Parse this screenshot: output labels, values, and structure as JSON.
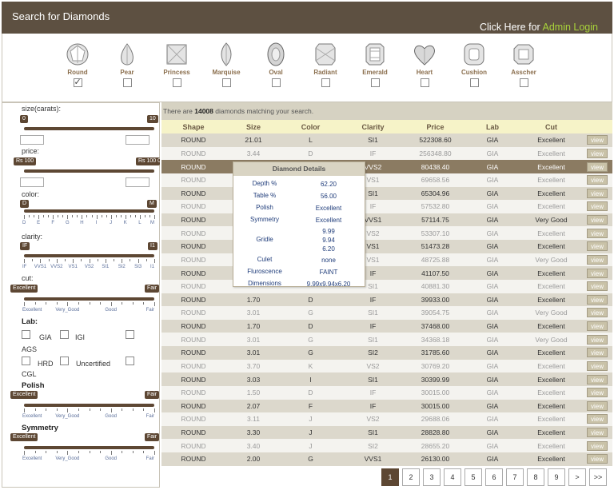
{
  "header": {
    "title": "Search for Diamonds",
    "admin_prefix": "Click Here for",
    "admin_link": "Admin Login"
  },
  "shapes": [
    {
      "label": "Round",
      "icon": "round-diamond-icon",
      "checked": true
    },
    {
      "label": "Pear",
      "icon": "pear-diamond-icon",
      "checked": false
    },
    {
      "label": "Princess",
      "icon": "princess-diamond-icon",
      "checked": false
    },
    {
      "label": "Marquise",
      "icon": "marquise-diamond-icon",
      "checked": false
    },
    {
      "label": "Oval",
      "icon": "oval-diamond-icon",
      "checked": false
    },
    {
      "label": "Radiant",
      "icon": "radiant-diamond-icon",
      "checked": false
    },
    {
      "label": "Emerald",
      "icon": "emerald-diamond-icon",
      "checked": false
    },
    {
      "label": "Heart",
      "icon": "heart-diamond-icon",
      "checked": false
    },
    {
      "label": "Cushion",
      "icon": "cushion-diamond-icon",
      "checked": false
    },
    {
      "label": "Asscher",
      "icon": "asscher-diamond-icon",
      "checked": false
    }
  ],
  "filters": {
    "size": {
      "label": "size(carats):",
      "min_label": "0",
      "max_label": "10"
    },
    "price": {
      "label": "price:",
      "min_label": "Rs 100",
      "max_label": "Rs 100 0"
    },
    "color": {
      "label": "color:",
      "min_label": "D",
      "max_label": "M",
      "ticks": [
        "D",
        "E",
        "F",
        "G",
        "H",
        "I",
        "J",
        "K",
        "L",
        "M"
      ]
    },
    "clarity": {
      "label": "clarity:",
      "min_label": "IF",
      "max_label": "I1",
      "ticks": [
        "IF",
        "VVS1",
        "VVS2",
        "VS1",
        "VS2",
        "SI1",
        "SI2",
        "SI3",
        "I1"
      ]
    },
    "cut": {
      "label": "cut:",
      "min_label": "Excellent",
      "max_label": "Fair",
      "ticks": [
        "Excellent",
        "Very_Good",
        "Good",
        "Fair"
      ]
    },
    "lab": {
      "label": "Lab:",
      "options": [
        "GIA",
        "IGI",
        "AGS",
        "HRD",
        "Uncertified",
        "CGL"
      ]
    },
    "polish": {
      "label": "Polish",
      "min_label": "Excellent",
      "max_label": "Fair",
      "ticks": [
        "Excellent",
        "Very_Good",
        "Good",
        "Fair"
      ]
    },
    "symmetry": {
      "label": "Symmetry",
      "min_label": "Excellent",
      "max_label": "Fair",
      "ticks": [
        "Excellent",
        "Very_Good",
        "Good",
        "Fair"
      ]
    }
  },
  "results": {
    "prefix": "There are",
    "count": "14008",
    "suffix": "diamonds matching your search.",
    "columns": [
      "Shape",
      "Size",
      "Color",
      "Clarity",
      "Price",
      "Lab",
      "Cut",
      ""
    ],
    "view_label": "view",
    "rows": [
      [
        "ROUND",
        "21.01",
        "L",
        "SI1",
        "522308.60",
        "GIA",
        "Excellent"
      ],
      [
        "ROUND",
        "3.44",
        "D",
        "IF",
        "256348.80",
        "GIA",
        "Excellent"
      ],
      [
        "ROUND",
        "",
        "",
        "VVS2",
        "80438.40",
        "GIA",
        "Excellent"
      ],
      [
        "ROUND",
        "",
        "",
        "VS1",
        "69658.56",
        "GIA",
        "Excellent"
      ],
      [
        "ROUND",
        "",
        "",
        "SI1",
        "65304.96",
        "GIA",
        "Excellent"
      ],
      [
        "ROUND",
        "",
        "",
        "IF",
        "57532.80",
        "GIA",
        "Excellent"
      ],
      [
        "ROUND",
        "",
        "",
        "VVS1",
        "57114.75",
        "GIA",
        "Very Good"
      ],
      [
        "ROUND",
        "",
        "",
        "VS2",
        "53307.10",
        "GIA",
        "Excellent"
      ],
      [
        "ROUND",
        "",
        "",
        "VS1",
        "51473.28",
        "GIA",
        "Excellent"
      ],
      [
        "ROUND",
        "",
        "",
        "VS1",
        "48725.88",
        "GIA",
        "Very Good"
      ],
      [
        "ROUND",
        "",
        "",
        "IF",
        "41107.50",
        "GIA",
        "Excellent"
      ],
      [
        "ROUND",
        "",
        "",
        "SI1",
        "40881.30",
        "GIA",
        "Excellent"
      ],
      [
        "ROUND",
        "1.70",
        "D",
        "IF",
        "39933.00",
        "GIA",
        "Excellent"
      ],
      [
        "ROUND",
        "3.01",
        "G",
        "SI1",
        "39054.75",
        "GIA",
        "Very Good"
      ],
      [
        "ROUND",
        "1.70",
        "D",
        "IF",
        "37468.00",
        "GIA",
        "Excellent"
      ],
      [
        "ROUND",
        "3.01",
        "G",
        "SI1",
        "34368.18",
        "GIA",
        "Very Good"
      ],
      [
        "ROUND",
        "3.01",
        "G",
        "SI2",
        "31785.60",
        "GIA",
        "Excellent"
      ],
      [
        "ROUND",
        "3.70",
        "K",
        "VS2",
        "30769.20",
        "GIA",
        "Excellent"
      ],
      [
        "ROUND",
        "3.03",
        "I",
        "SI1",
        "30399.99",
        "GIA",
        "Excellent"
      ],
      [
        "ROUND",
        "1.50",
        "D",
        "IF",
        "30015.00",
        "GIA",
        "Excellent"
      ],
      [
        "ROUND",
        "2.07",
        "F",
        "IF",
        "30015.00",
        "GIA",
        "Excellent"
      ],
      [
        "ROUND",
        "3.11",
        "J",
        "VS2",
        "29688.06",
        "GIA",
        "Excellent"
      ],
      [
        "ROUND",
        "3.30",
        "J",
        "SI1",
        "28828.80",
        "GIA",
        "Excellent"
      ],
      [
        "ROUND",
        "3.40",
        "J",
        "SI2",
        "28655.20",
        "GIA",
        "Excellent"
      ],
      [
        "ROUND",
        "2.00",
        "G",
        "VVS1",
        "26130.00",
        "GIA",
        "Excellent"
      ]
    ]
  },
  "popup": {
    "title": "Diamond Details",
    "rows": [
      {
        "k": "Depth %",
        "v": "62.20"
      },
      {
        "k": "Table %",
        "v": "56.00"
      },
      {
        "k": "Polish",
        "v": "Excellent"
      },
      {
        "k": "Symmetry",
        "v": "Excellent"
      },
      {
        "k": "Gridle",
        "v": "9.99\n9.94\n6.20"
      },
      {
        "k": "Culet",
        "v": "none"
      },
      {
        "k": "Fluroscence",
        "v": "FAINT"
      },
      {
        "k": "Dimensions",
        "v": "9.99x9.94x6.20"
      }
    ]
  },
  "pagination": {
    "pages": [
      "1",
      "2",
      "3",
      "4",
      "5",
      "6",
      "7",
      "8",
      "9"
    ],
    "current": "1",
    "next": ">",
    "last": ">>"
  },
  "colors": {
    "brand": "#5d5041",
    "accent": "#a8d23a",
    "row_dark": "#dcd8cc",
    "row_light": "#f4f3ef",
    "row_highlight": "#8b7b62"
  }
}
